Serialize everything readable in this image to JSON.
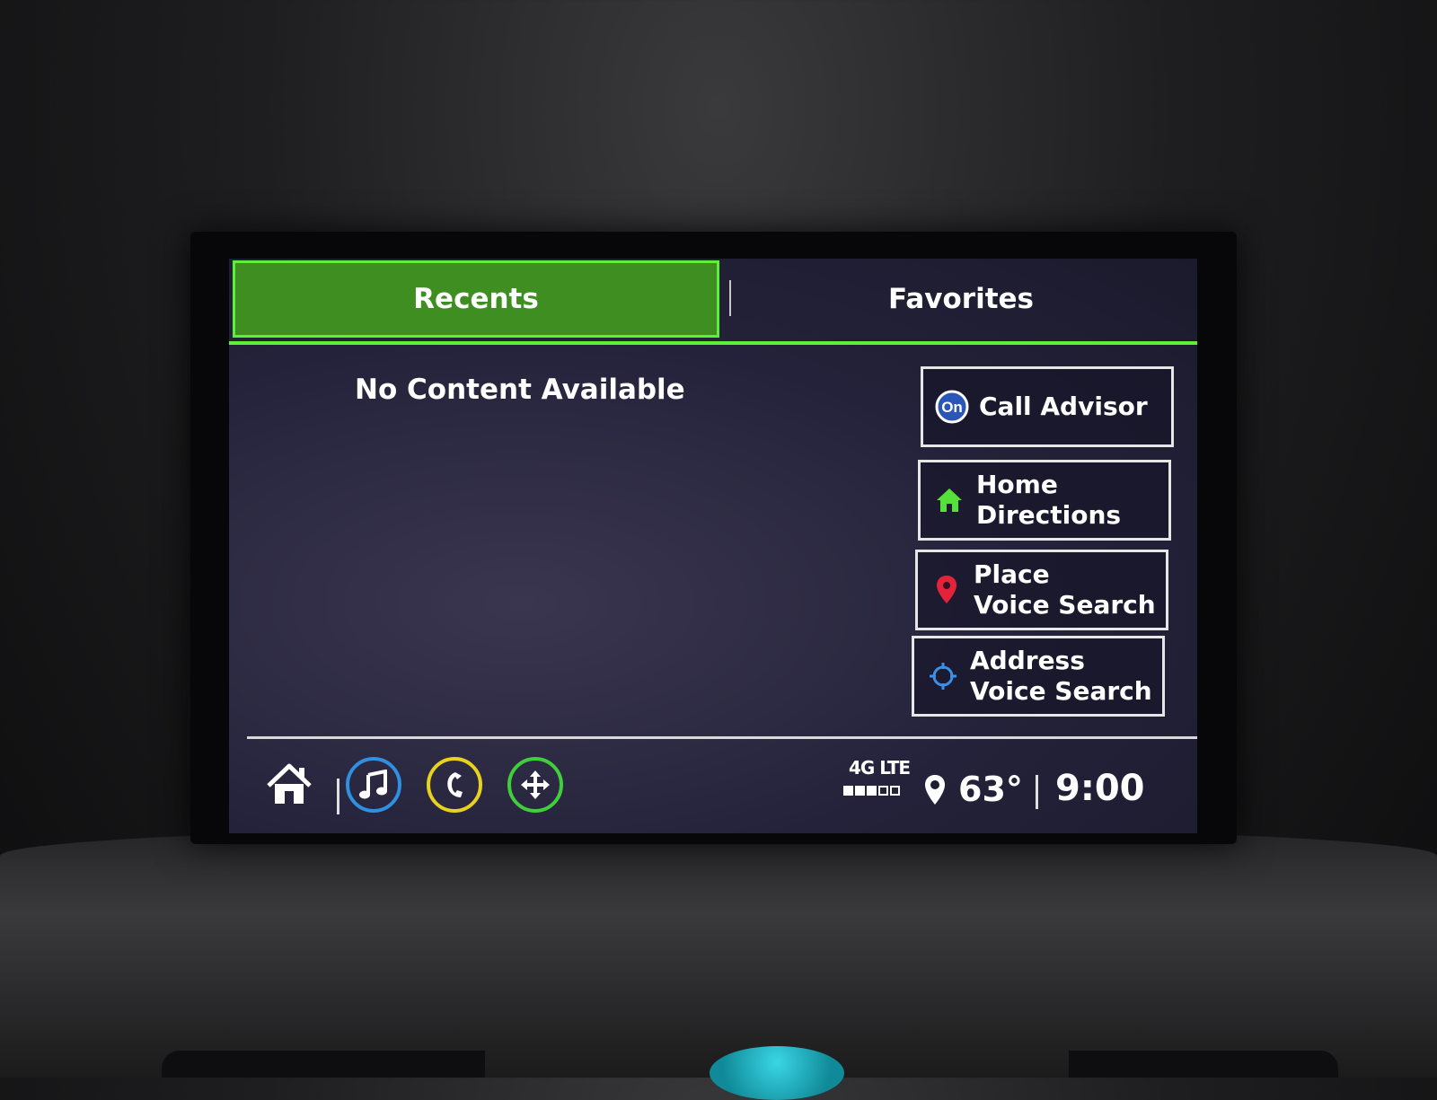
{
  "tabs": [
    {
      "label": "Recents",
      "active": true
    },
    {
      "label": "Favorites",
      "active": false
    }
  ],
  "content": {
    "empty_message": "No Content Available"
  },
  "actions": [
    {
      "icon": "onstar-icon",
      "lines": [
        "Call Advisor"
      ]
    },
    {
      "icon": "home-icon",
      "lines": [
        "Home",
        "Directions"
      ]
    },
    {
      "icon": "map-pin-icon",
      "lines": [
        "Place",
        "Voice Search"
      ]
    },
    {
      "icon": "crosshair-icon",
      "lines": [
        "Address",
        "Voice Search"
      ]
    }
  ],
  "status": {
    "network": "4G LTE",
    "signal_bars": 3,
    "signal_bars_max": 5,
    "temperature": "63°",
    "time": "9:00"
  },
  "colors": {
    "accent_green": "#5df03a",
    "tab_active_fill": "#3e8e22",
    "audio_ring": "#2f8fe0",
    "phone_ring": "#e8d21e",
    "nav_ring": "#3ecf3a",
    "place_pin": "#e2233a"
  }
}
